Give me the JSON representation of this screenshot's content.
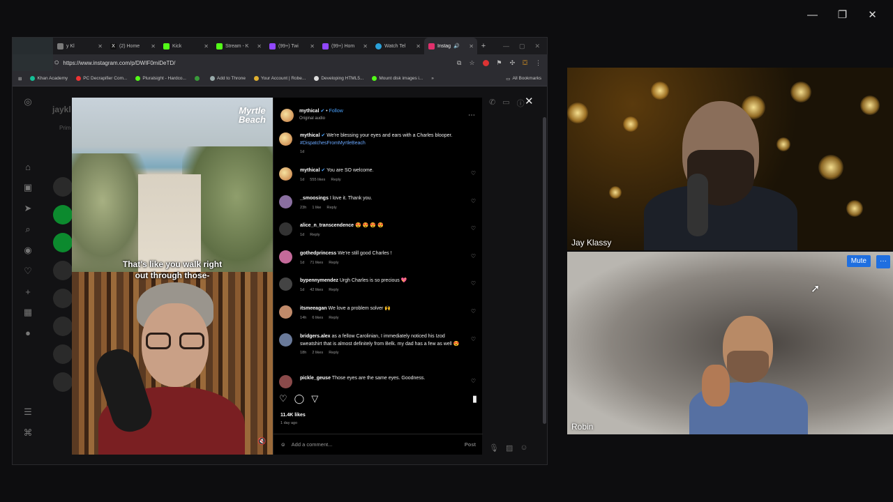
{
  "browser": {
    "tabs": [
      {
        "label": "y Kl",
        "color": "#7a7a7a"
      },
      {
        "label": "(2) Home",
        "color": "#ffffff"
      },
      {
        "label": "Kick",
        "color": "#53fc18"
      },
      {
        "label": "Stream - K",
        "color": "#53fc18"
      },
      {
        "label": "(99+) Twi",
        "color": "#9147ff"
      },
      {
        "label": "(99+) Hom",
        "color": "#9147ff"
      },
      {
        "label": "Watch Tel",
        "color": "#2aa1d9"
      },
      {
        "label": "Instag",
        "color": "#e1306c"
      }
    ],
    "url": "https://www.instagram.com/p/DWIF0miDeTD/",
    "bookmarks": [
      {
        "label": "Khan Academy",
        "color": "#14bf96"
      },
      {
        "label": "PC Decrapifier Com...",
        "color": "#e33"
      },
      {
        "label": "Pluralsight - Hardco...",
        "color": "#53fc18"
      },
      {
        "label": "",
        "color": "#3a9a3a"
      },
      {
        "label": "Add to Throne",
        "color": "#9aa"
      },
      {
        "label": "Your Account | Robe...",
        "color": "#e0b030"
      },
      {
        "label": "Developing HTML5...",
        "color": "#ddd"
      },
      {
        "label": "Mount disk images i...",
        "color": "#53fc18"
      }
    ],
    "all_bookmarks": "All Bookmarks"
  },
  "instagram": {
    "bg_title": "jaykl",
    "bg_tab": "Prim",
    "video": {
      "logo_line1": "Myrtle",
      "logo_line2": "Beach",
      "caption_line1": "That's like you walk right",
      "caption_line2": "out through those-"
    },
    "post": {
      "username": "mythical",
      "follow": "Follow",
      "audio": "Original audio",
      "caption_user": "mythical",
      "caption_text": "We're blessing your eyes and ears with a Charles blooper.",
      "caption_tag": "#DispatchesFromMyrtleBeach",
      "caption_age": "1d",
      "likes": "11.4K likes",
      "ago": "1 day ago",
      "add_comment": "Add a comment...",
      "post_label": "Post"
    },
    "comments": [
      {
        "user": "mythical",
        "text": "You are SO welcome.",
        "age": "1d",
        "likes": "555 likes",
        "reply": "Reply",
        "avatar": "#d2955a"
      },
      {
        "user": "_smoosings",
        "text": "I love it. Thank you.",
        "age": "23h",
        "likes": "1 like",
        "reply": "Reply",
        "avatar": "#8a6fa0"
      },
      {
        "user": "alice_n_transcendence",
        "text": "😍 😍 😍 😍",
        "age": "1d",
        "likes": "",
        "reply": "Reply",
        "avatar": "#333"
      },
      {
        "user": "gothedprincess",
        "text": "We're still good Charles !",
        "age": "1d",
        "likes": "71 likes",
        "reply": "Reply",
        "avatar": "#c46a9a"
      },
      {
        "user": "bypennymendez",
        "text": "Urgh Charles is so precious 💖",
        "age": "1d",
        "likes": "42 likes",
        "reply": "Reply",
        "avatar": "#444"
      },
      {
        "user": "itsmeeagan",
        "text": "We love a problem solver 🙌",
        "age": "14h",
        "likes": "6 likes",
        "reply": "Reply",
        "avatar": "#c08a6a"
      },
      {
        "user": "bridgers.alex",
        "text": "as a fellow Carolinian, I immediately noticed his Izod sweatshirt that is almost definitely from Belk. my dad has a few as well 😍",
        "age": "18h",
        "likes": "2 likes",
        "reply": "Reply",
        "avatar": "#6a7a9a"
      },
      {
        "user": "pickle_geuse",
        "text": "Those eyes are the same eyes. Goodness.",
        "age": "",
        "likes": "",
        "reply": "",
        "avatar": "#8a4a4a"
      }
    ]
  },
  "call": {
    "participant1": "Jay Klassy",
    "participant2": "Robin",
    "mute_label": "Mute",
    "more_label": "···"
  }
}
